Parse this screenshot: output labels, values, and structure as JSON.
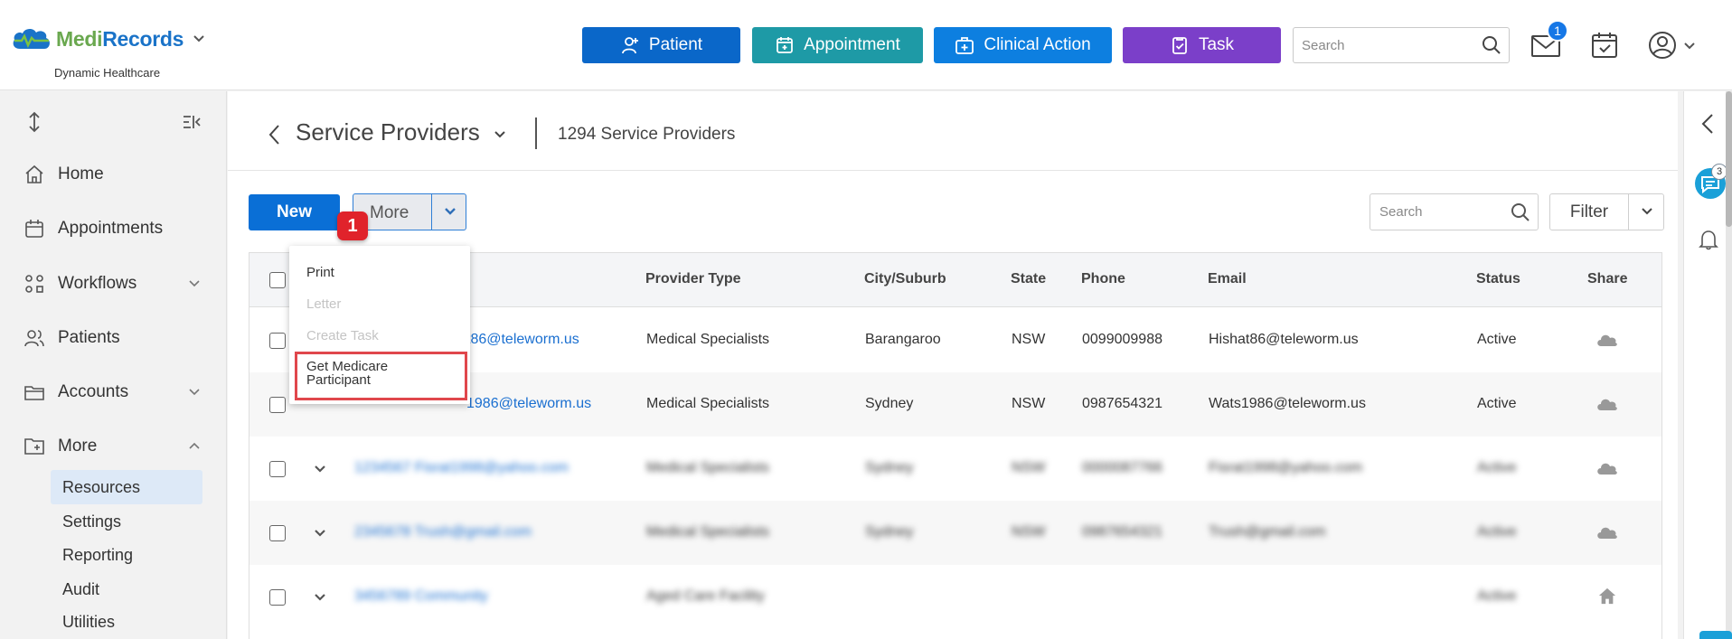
{
  "app": {
    "brand_part1": "Medi",
    "brand_part2": "Records",
    "org": "Dynamic Healthcare"
  },
  "header": {
    "buttons": {
      "patient": "Patient",
      "appointment": "Appointment",
      "clinical_action": "Clinical Action",
      "task": "Task"
    },
    "search_placeholder": "Search",
    "mail_badge": "1",
    "colors": {
      "patient": "#0a67c9",
      "appointment": "#1e9aa6",
      "clinical_action": "#0d7fe0",
      "task": "#7b3fc9"
    }
  },
  "sidebar": {
    "items": [
      {
        "label": "Home",
        "icon": "home-icon"
      },
      {
        "label": "Appointments",
        "icon": "calendar-icon"
      },
      {
        "label": "Workflows",
        "icon": "workflow-icon",
        "chevron": "down"
      },
      {
        "label": "Patients",
        "icon": "users-icon"
      },
      {
        "label": "Accounts",
        "icon": "folder-icon",
        "chevron": "down"
      },
      {
        "label": "More",
        "icon": "folder-plus-icon",
        "chevron": "up"
      }
    ],
    "sub_items": [
      {
        "label": "Resources",
        "active": true
      },
      {
        "label": "Settings"
      },
      {
        "label": "Reporting"
      },
      {
        "label": "Audit"
      },
      {
        "label": "Utilities"
      }
    ]
  },
  "rail": {
    "chat_badge": "3"
  },
  "page": {
    "title": "Service Providers",
    "count": "1294 Service Providers",
    "new_label": "New",
    "more_label": "More",
    "search_placeholder": "Search",
    "filter_label": "Filter"
  },
  "menu": {
    "items": [
      {
        "label": "Print",
        "disabled": false
      },
      {
        "label": "Letter",
        "disabled": true
      },
      {
        "label": "Create Task",
        "disabled": true
      },
      {
        "label": "Get Medicare Participant",
        "disabled": false,
        "highlighted": true
      }
    ],
    "step_number": "1"
  },
  "table": {
    "columns": [
      "Provider Type",
      "City/Suburb",
      "State",
      "Phone",
      "Email",
      "Status",
      "Share"
    ],
    "rows": [
      {
        "name": "t86@teleworm.us",
        "type": "Medical Specialists",
        "city": "Barangaroo",
        "state": "NSW",
        "phone": "0099009988",
        "email": "Hishat86@teleworm.us",
        "status": "Active",
        "share": "cloud"
      },
      {
        "name": "1986@teleworm.us",
        "type": "Medical Specialists",
        "city": "Sydney",
        "state": "NSW",
        "phone": "0987654321",
        "email": "Wats1986@teleworm.us",
        "status": "Active",
        "share": "cloud"
      },
      {
        "name": "1234567 Fisrat1998@yahoo.com",
        "type": "Medical Specialists",
        "city": "Sydney",
        "state": "NSW",
        "phone": "0000087766",
        "email": "Fisrat1998@yahoo.com",
        "status": "Active",
        "share": "cloud"
      },
      {
        "name": "2345678 Trush@gmail.com",
        "type": "Medical Specialists",
        "city": "Sydney",
        "state": "NSW",
        "phone": "0987654321",
        "email": "Trush@gmail.com",
        "status": "Active",
        "share": "cloud"
      },
      {
        "name": "3456789 Community",
        "type": "Aged Care Facility",
        "city": "",
        "state": "",
        "phone": "",
        "email": "",
        "status": "Active",
        "share": "home"
      }
    ]
  }
}
